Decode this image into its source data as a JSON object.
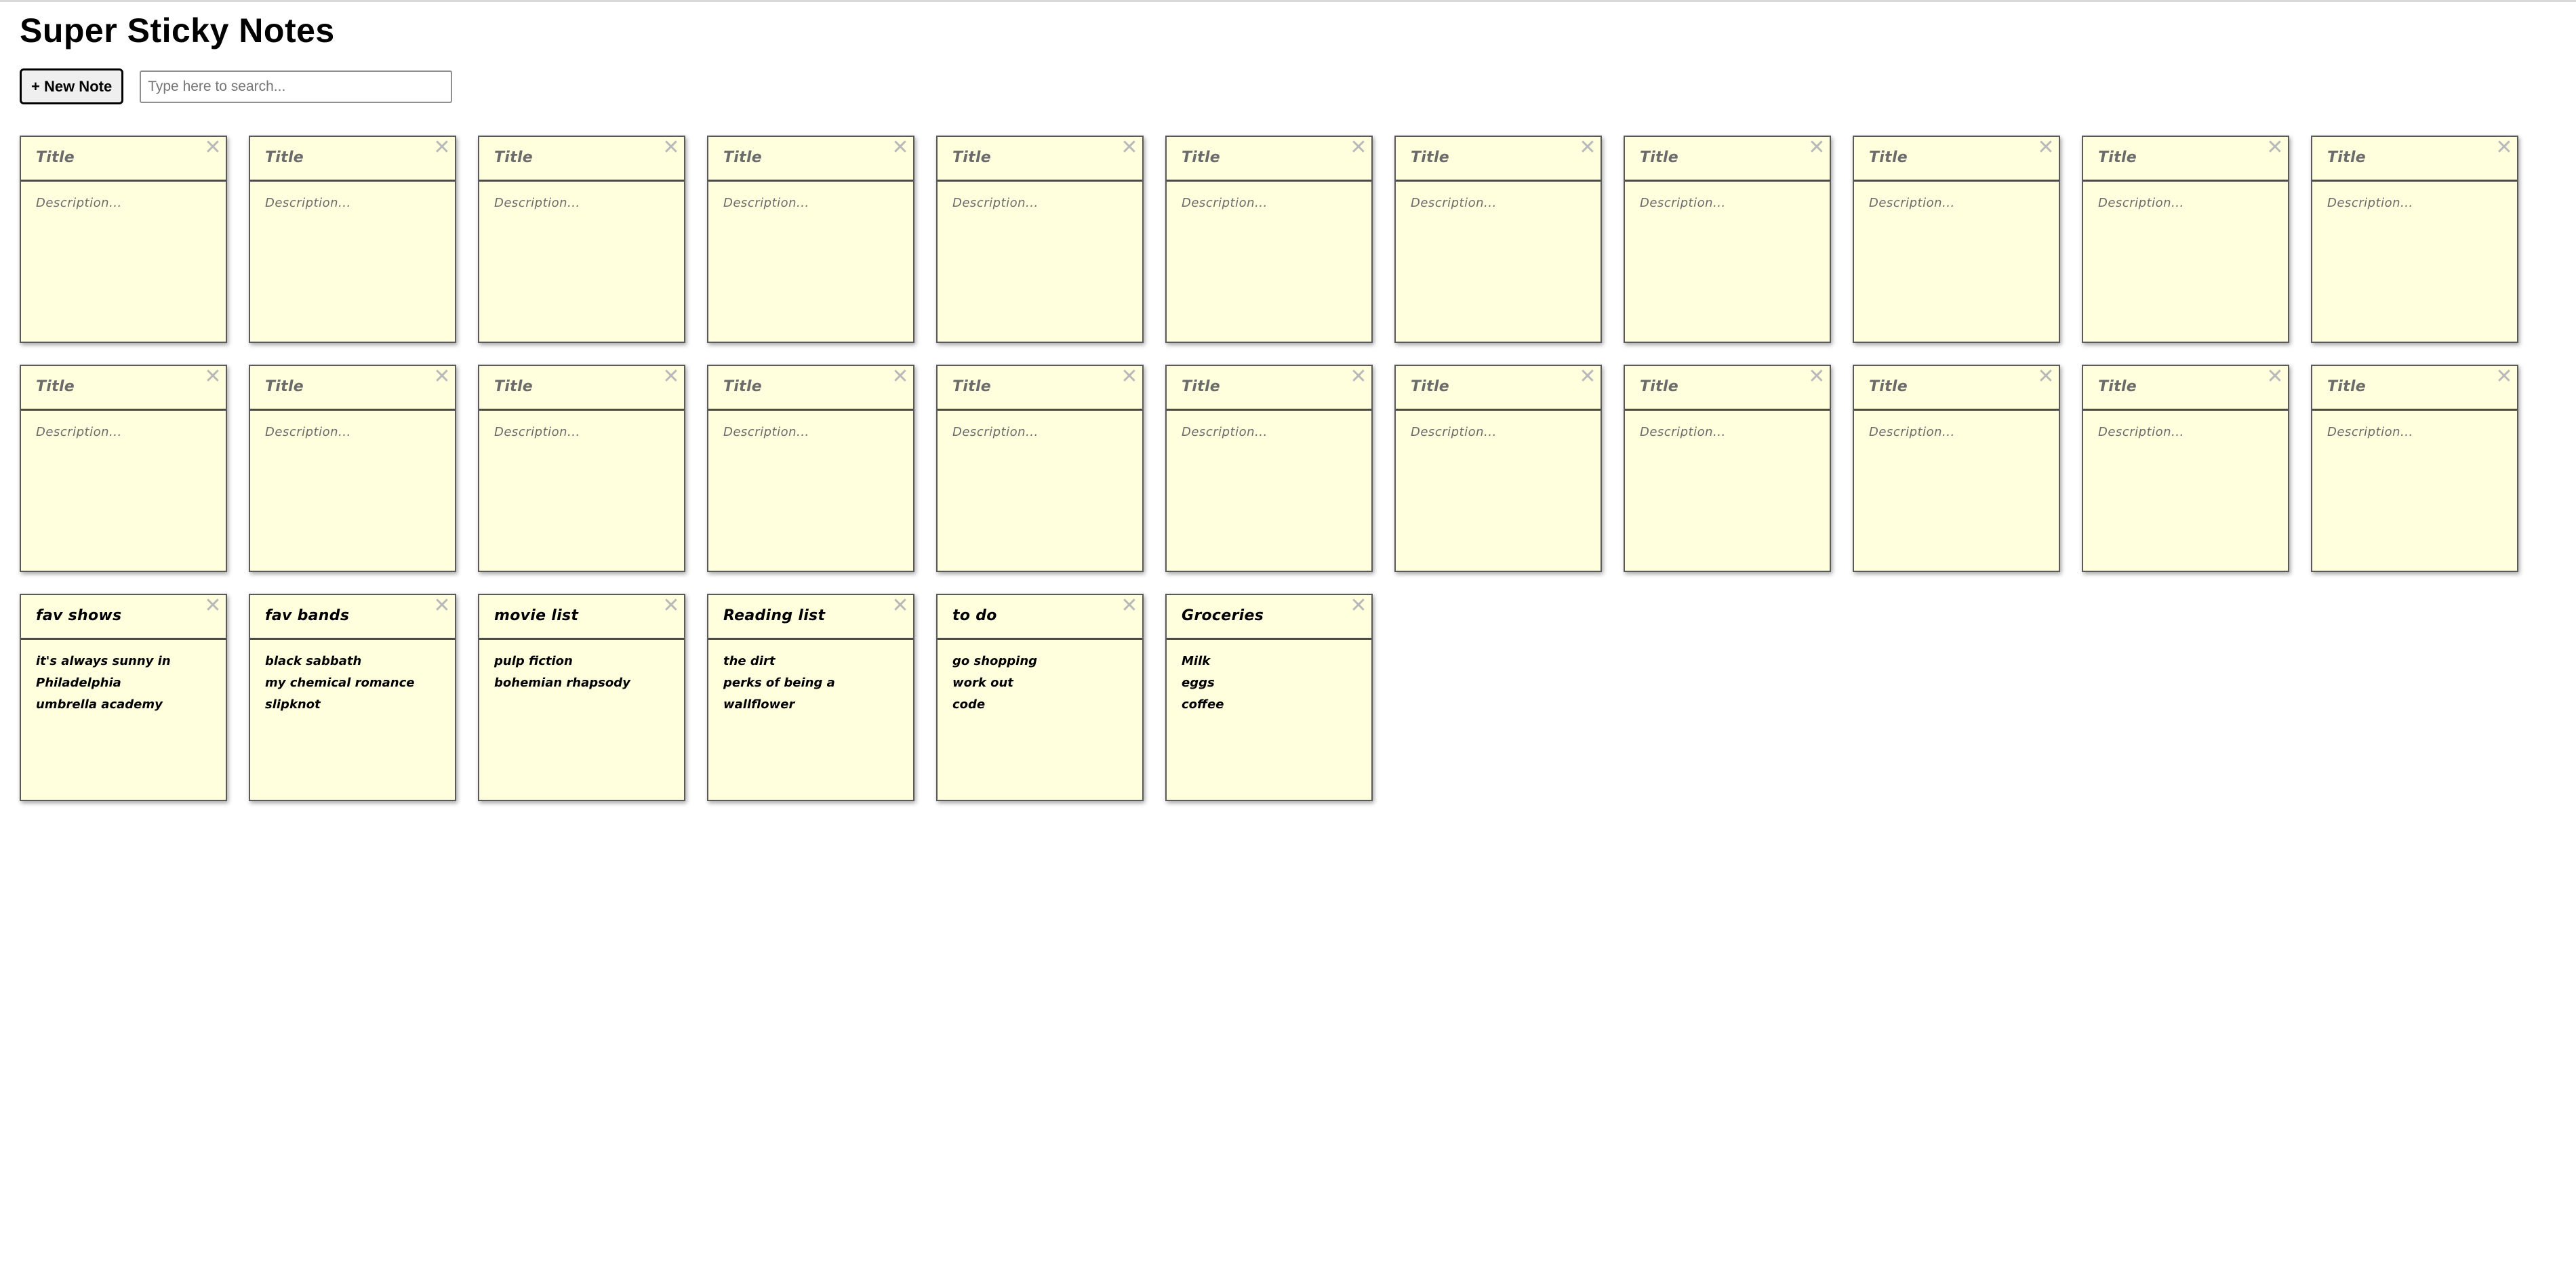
{
  "app": {
    "title": "Super Sticky Notes"
  },
  "toolbar": {
    "new_note_label": "+ New Note",
    "search_placeholder": "Type here to search...",
    "search_value": ""
  },
  "note_placeholders": {
    "title": "Title",
    "description": "Description..."
  },
  "note_close_glyph": "✕",
  "colors": {
    "note_background": "#ffffde",
    "note_border": "#5a5a5a",
    "placeholder_text": "#6b6b6b",
    "close_icon": "#b9b9b9"
  },
  "notes": [
    {
      "title": "",
      "description": ""
    },
    {
      "title": "",
      "description": ""
    },
    {
      "title": "",
      "description": ""
    },
    {
      "title": "",
      "description": ""
    },
    {
      "title": "",
      "description": ""
    },
    {
      "title": "",
      "description": ""
    },
    {
      "title": "",
      "description": ""
    },
    {
      "title": "",
      "description": ""
    },
    {
      "title": "",
      "description": ""
    },
    {
      "title": "",
      "description": ""
    },
    {
      "title": "",
      "description": ""
    },
    {
      "title": "",
      "description": ""
    },
    {
      "title": "",
      "description": ""
    },
    {
      "title": "",
      "description": ""
    },
    {
      "title": "",
      "description": ""
    },
    {
      "title": "",
      "description": ""
    },
    {
      "title": "",
      "description": ""
    },
    {
      "title": "",
      "description": ""
    },
    {
      "title": "",
      "description": ""
    },
    {
      "title": "",
      "description": ""
    },
    {
      "title": "",
      "description": ""
    },
    {
      "title": "",
      "description": ""
    },
    {
      "title": "fav shows",
      "description": "it's always sunny in\nPhiladelphia\numbrella academy"
    },
    {
      "title": "fav bands",
      "description": "black sabbath\nmy chemical romance\nslipknot"
    },
    {
      "title": "movie list",
      "description": "pulp fiction\nbohemian rhapsody"
    },
    {
      "title": "Reading list",
      "description": "the dirt\nperks of being a\nwallflower"
    },
    {
      "title": "to do",
      "description": "go shopping\nwork out\ncode"
    },
    {
      "title": "Groceries",
      "description": "Milk\neggs\ncoffee"
    }
  ]
}
